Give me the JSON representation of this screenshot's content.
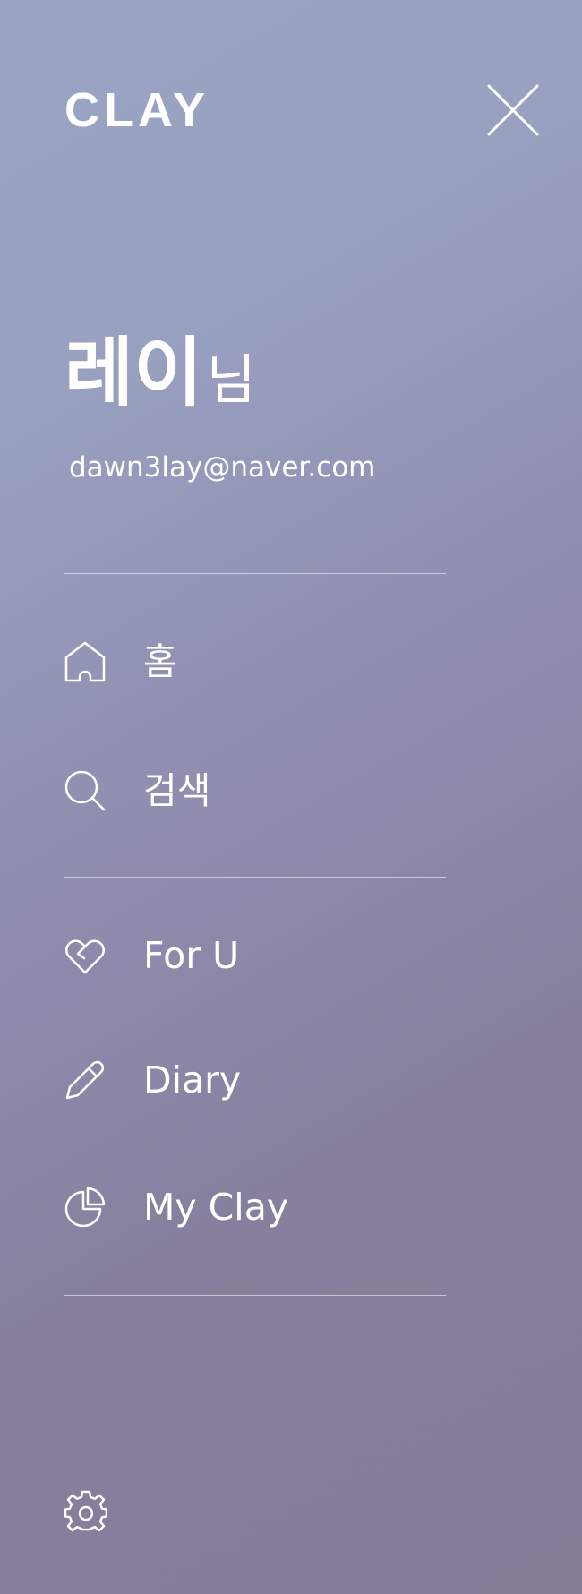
{
  "header": {
    "logo_text": "CLAY",
    "close_icon": "close-icon"
  },
  "profile": {
    "name": "레이",
    "suffix": "님",
    "email": "dawn3lay@naver.com"
  },
  "menu": {
    "primary": [
      {
        "label": "홈",
        "icon": "home-icon"
      },
      {
        "label": "검색",
        "icon": "search-icon"
      }
    ],
    "secondary": [
      {
        "label": "For U",
        "icon": "heart-icon"
      },
      {
        "label": "Diary",
        "icon": "pencil-icon"
      },
      {
        "label": "My Clay",
        "icon": "pie-chart-icon"
      }
    ]
  },
  "footer": {
    "settings_icon": "gear-icon"
  },
  "colors": {
    "gradient_top": "#99a4c4",
    "gradient_bottom": "#857c98",
    "text": "#ffffff"
  }
}
